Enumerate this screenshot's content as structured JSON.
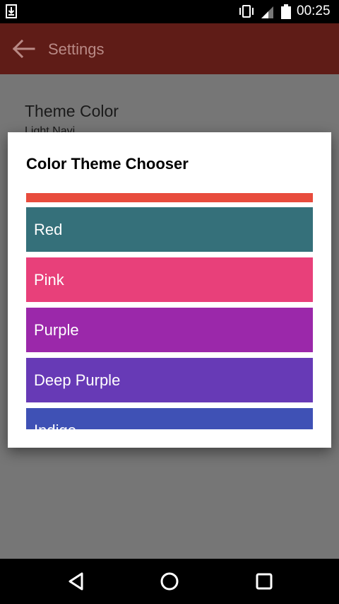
{
  "status_bar": {
    "time": "00:25",
    "icons": [
      "download-icon",
      "vibrate-icon",
      "signal-icon",
      "battery-icon"
    ]
  },
  "app_bar": {
    "title": "Settings",
    "back_icon": "arrow-back-icon",
    "background": "#5f1c17"
  },
  "settings": {
    "theme_color_title": "Theme Color",
    "theme_color_value": "Light Navi"
  },
  "dialog": {
    "title": "Color Theme Chooser",
    "top_strip_color": "#e84c3d",
    "themes": [
      {
        "label": "Red",
        "color": "#35707a"
      },
      {
        "label": "Pink",
        "color": "#e8407a"
      },
      {
        "label": "Purple",
        "color": "#9b28aa"
      },
      {
        "label": "Deep Purple",
        "color": "#673ab6"
      },
      {
        "label": "Indigo",
        "color": "#3f51b5"
      }
    ]
  },
  "nav_bar": {
    "buttons": [
      "back-triangle-icon",
      "home-circle-icon",
      "recents-square-icon"
    ]
  }
}
